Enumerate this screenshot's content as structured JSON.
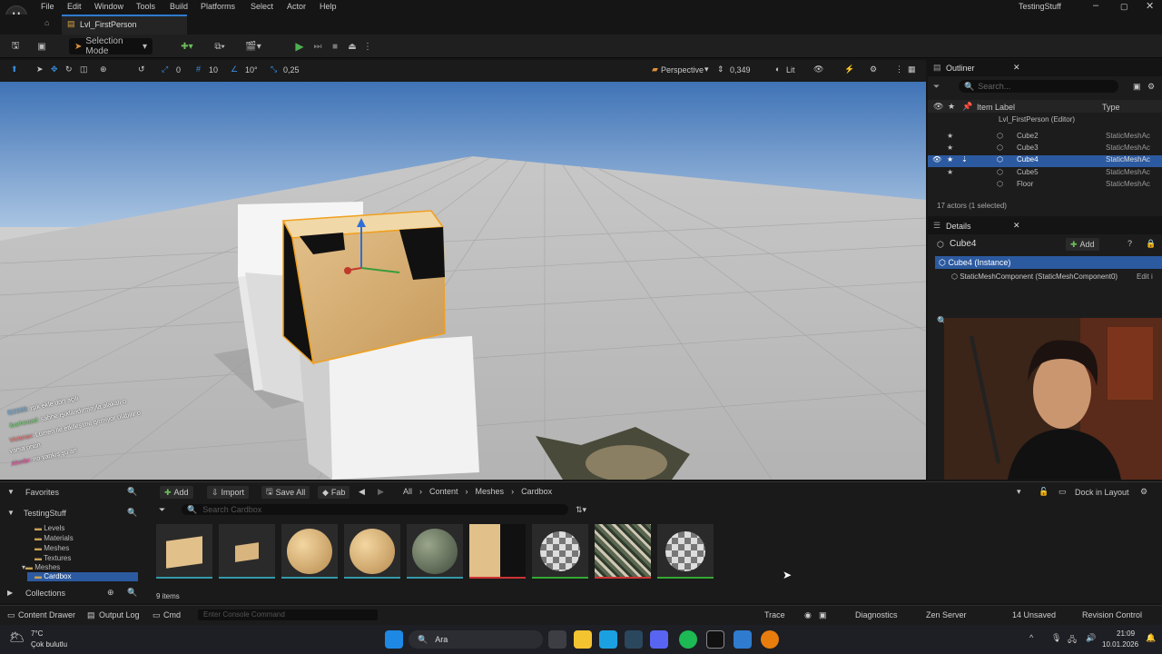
{
  "app": {
    "title": "TestingStuff",
    "level_tab": "Lvl_FirstPerson"
  },
  "menu": [
    "File",
    "Edit",
    "Window",
    "Tools",
    "Build",
    "Platforms",
    "Select",
    "Actor",
    "Help"
  ],
  "toolbar": {
    "selection_mode": "Selection Mode"
  },
  "viewport_toolbar": {
    "grid_snap": "10",
    "rotation_snap": "10°",
    "scale_snap": "0,25",
    "view_mode_label": "Perspective",
    "camera_speed": "0,349",
    "lighting_label": "Lit",
    "translate_snap": "0"
  },
  "outliner": {
    "title": "Outliner",
    "search_placeholder": "Search...",
    "col_label": "Item Label",
    "col_type": "Type",
    "root": "Lvl_FirstPerson (Editor)",
    "rows": [
      {
        "label": "Cube2",
        "type": "StaticMeshAc"
      },
      {
        "label": "Cube3",
        "type": "StaticMeshAc"
      },
      {
        "label": "Cube4",
        "type": "StaticMeshAc",
        "selected": true
      },
      {
        "label": "Cube5",
        "type": "StaticMeshAc"
      },
      {
        "label": "Floor",
        "type": "StaticMeshAc"
      }
    ],
    "summary": "17 actors (1 selected)"
  },
  "details": {
    "title": "Details",
    "object_name": "Cube4",
    "add_label": "Add",
    "instance_label": "Cube4 (Instance)",
    "component_label": "StaticMeshComponent (StaticMeshComponent0)",
    "edit_label": "Edit i"
  },
  "content_browser": {
    "add_label": "Add",
    "import_label": "Import",
    "save_all_label": "Save All",
    "fab_label": "Fab",
    "breadcrumb": [
      "All",
      "Content",
      "Meshes",
      "Cardbox"
    ],
    "dock_label": "Dock in Layout",
    "search_placeholder": "Search Cardbox",
    "favorites": "Favorites",
    "project": "TestingStuff",
    "folders": [
      "Levels",
      "Materials",
      "Meshes",
      "Textures"
    ],
    "meshes_folder": "Meshes",
    "selected_folder": "Cardbox",
    "collections": "Collections",
    "item_count": "9 items"
  },
  "chat_overlay": [
    {
      "user": "f22333:",
      "text": "ışık ekle dört açılı"
    },
    {
      "user": "ibarheaad:",
      "text": "sahne ışıklandırmayla alakalı o"
    },
    {
      "user": "Victorax:",
      "text": "Lumen ile etkileşime girmiyor olabilir o"
    },
    {
      "user": "",
      "text": "varsa onun"
    },
    {
      "user": "Ahmbr:",
      "text": "no yankış şu an"
    }
  ],
  "statusbar": {
    "content_drawer": "Content Drawer",
    "output_log": "Output Log",
    "cmd": "Cmd",
    "console_placeholder": "Enter Console Command",
    "trace": "Trace",
    "diagnostics": "Diagnostics",
    "zen_server": "Zen Server",
    "unsaved": "14 Unsaved",
    "revision_control": "Revision Control"
  },
  "taskbar": {
    "weather_temp": "7°C",
    "weather_desc": "Çok bulutlu",
    "search_label": "Ara",
    "time": "21:09",
    "date": "10.01.2026"
  },
  "colors": {
    "accent": "#2e7bcf",
    "selection": "#2c5aa0",
    "play_green": "#4caf50"
  }
}
